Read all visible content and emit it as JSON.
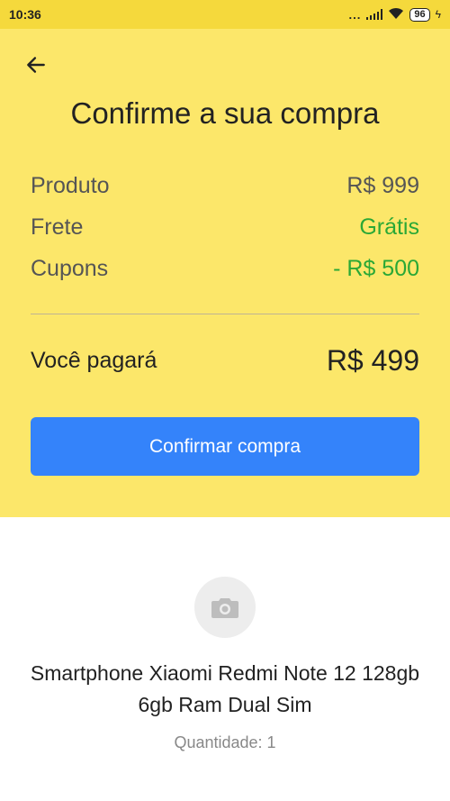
{
  "status_bar": {
    "time": "10:36",
    "dots": "...",
    "battery": "96"
  },
  "header": {
    "back_icon": "arrow-left-icon",
    "title": "Confirme a sua compra"
  },
  "summary": {
    "rows": [
      {
        "label": "Produto",
        "value": "R$ 999"
      },
      {
        "label": "Frete",
        "value": "Grátis"
      },
      {
        "label": "Cupons",
        "value": "- R$ 500"
      }
    ],
    "total_label": "Você pagará",
    "total_value": "R$ 499"
  },
  "confirm_button": {
    "label": "Confirmar compra"
  },
  "product": {
    "image_icon": "camera-icon",
    "title": "Smartphone Xiaomi Redmi Note 12 128gb 6gb Ram Dual Sim",
    "quantity": "Quantidade: 1"
  },
  "colors": {
    "header_bg": "#fce76a",
    "accent_blue": "#3483fa",
    "green": "#2aa836"
  }
}
